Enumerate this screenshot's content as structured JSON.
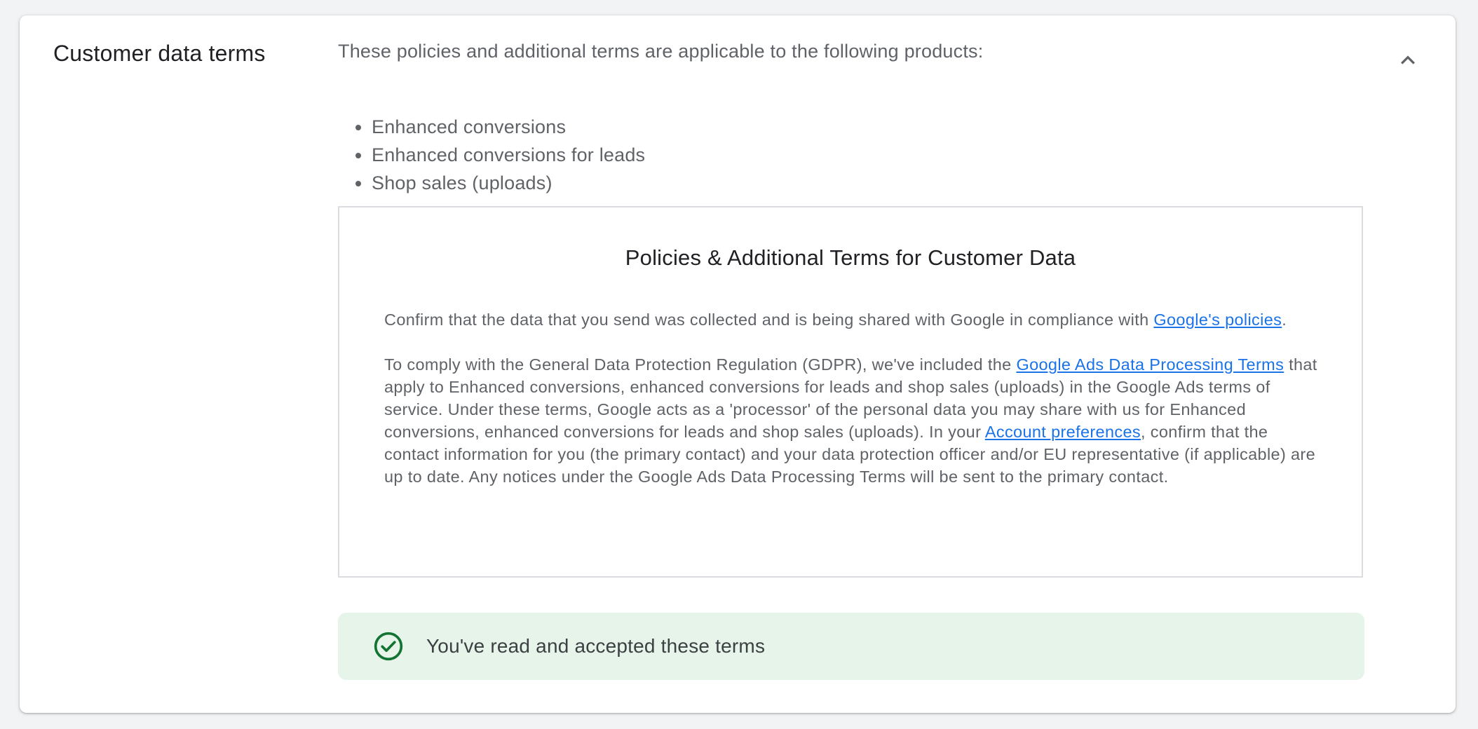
{
  "section": {
    "title": "Customer data terms",
    "collapse_icon": "chevron-up-icon"
  },
  "intro": "These policies and additional terms are applicable to the following products:",
  "products": [
    "Enhanced conversions",
    "Enhanced conversions for leads",
    "Shop sales (uploads)"
  ],
  "terms": {
    "title": "Policies & Additional Terms for Customer Data",
    "p1": {
      "text_before": "Confirm that the data that you send was collected and is being shared with Google in compliance with ",
      "link": "Google's policies",
      "text_after": "."
    },
    "p2": {
      "text_before": "To comply with the General Data Protection Regulation (GDPR), we've included the ",
      "link1": "Google Ads Data Processing Terms",
      "text_middle": " that apply to Enhanced conversions, enhanced conversions for leads and shop sales (uploads) in the Google Ads terms of service. Under these terms, Google acts as a 'processor' of the personal data you may share with us for Enhanced conversions, enhanced conversions for leads and shop sales (uploads). In your ",
      "link2": "Account preferences",
      "text_after": ", confirm that the contact information for you (the primary contact) and your data protection officer and/or EU representative (if applicable) are up to date. Any notices under the Google Ads Data Processing Terms will be sent to the primary contact."
    }
  },
  "accepted": {
    "text": "You've read and accepted these terms",
    "icon": "check-circle-icon"
  },
  "colors": {
    "link": "#1a73e8",
    "accepted_bg": "#e6f4ea",
    "check_green": "#137333"
  }
}
